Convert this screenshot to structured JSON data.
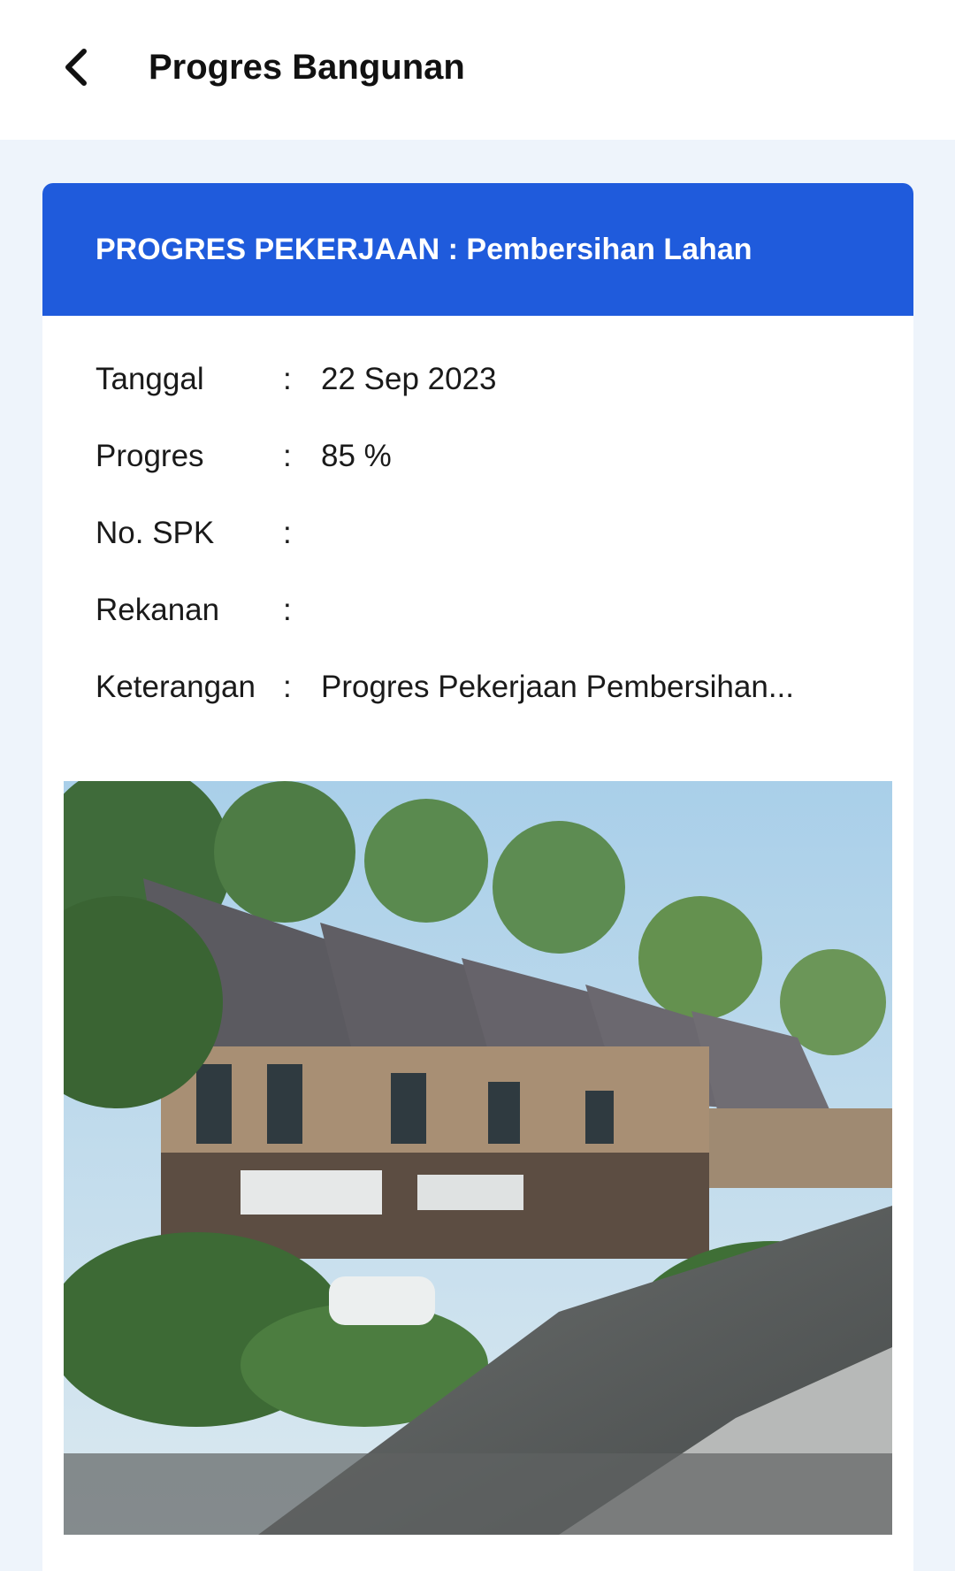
{
  "app_bar": {
    "title": "Progres Bangunan",
    "back_icon": "chevron-left-icon"
  },
  "card": {
    "header_title": "PROGRES PEKERJAAN : Pembersihan Lahan",
    "header_color": "#1f5bdc",
    "fields": [
      {
        "label": "Tanggal",
        "separator": ":",
        "value": "22 Sep 2023"
      },
      {
        "label": "Progres",
        "separator": ":",
        "value": "85 %"
      },
      {
        "label": "No. SPK",
        "separator": ":",
        "value": ""
      },
      {
        "label": "Rekanan",
        "separator": ":",
        "value": ""
      },
      {
        "label": "Keterangan",
        "separator": ":",
        "value": "Progres Pekerjaan Pembersihan..."
      }
    ],
    "progress_percent": 85
  }
}
